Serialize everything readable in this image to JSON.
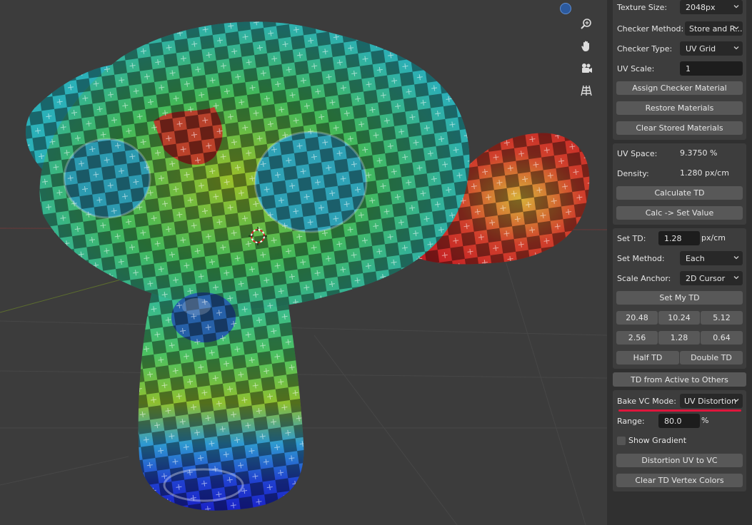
{
  "viewport": {
    "gizmos": [
      {
        "name": "zoom-icon"
      },
      {
        "name": "hand-pan-icon"
      },
      {
        "name": "camera-icon"
      },
      {
        "name": "grid-view-icon"
      }
    ]
  },
  "panel_checker": {
    "texture_size_label": "Texture Size:",
    "texture_size_value": "2048px",
    "checker_method_label": "Checker Method:",
    "checker_method_value": "Store and R...",
    "checker_type_label": "Checker Type:",
    "checker_type_value": "UV Grid",
    "uv_scale_label": "UV Scale:",
    "uv_scale_value": "1",
    "assign_button": "Assign Checker Material",
    "restore_button": "Restore Materials",
    "clear_stored_button": "Clear Stored Materials"
  },
  "panel_calc": {
    "uv_space_label": "UV Space:",
    "uv_space_value": "9.3750 %",
    "density_label": "Density:",
    "density_value": "1.280 px/cm",
    "calculate_button": "Calculate TD",
    "calc_set_button": "Calc -> Set Value"
  },
  "panel_set": {
    "set_td_label": "Set TD:",
    "set_td_value": "1.28",
    "set_td_unit": "px/cm",
    "set_method_label": "Set Method:",
    "set_method_value": "Each",
    "scale_anchor_label": "Scale Anchor:",
    "scale_anchor_value": "2D Cursor",
    "set_my_td_button": "Set My TD",
    "presets_row1": [
      "20.48",
      "10.24",
      "5.12"
    ],
    "presets_row2": [
      "2.56",
      "1.28",
      "0.64"
    ],
    "half_td_button": "Half TD",
    "double_td_button": "Double TD"
  },
  "td_from_active_button": "TD from Active to Others",
  "panel_bake": {
    "bake_mode_label": "Bake VC Mode:",
    "bake_mode_value": "UV Distortion",
    "range_label": "Range:",
    "range_value": "80.0",
    "range_unit": "%",
    "show_gradient_label": "Show Gradient",
    "distortion_button": "Distortion UV to VC",
    "clear_td_button": "Clear TD Vertex Colors"
  },
  "colors": {
    "accent_underline": "#e0163c",
    "panel_bg": "#3d3d3d",
    "button_bg": "#585858",
    "field_bg": "#1d1d1d"
  }
}
